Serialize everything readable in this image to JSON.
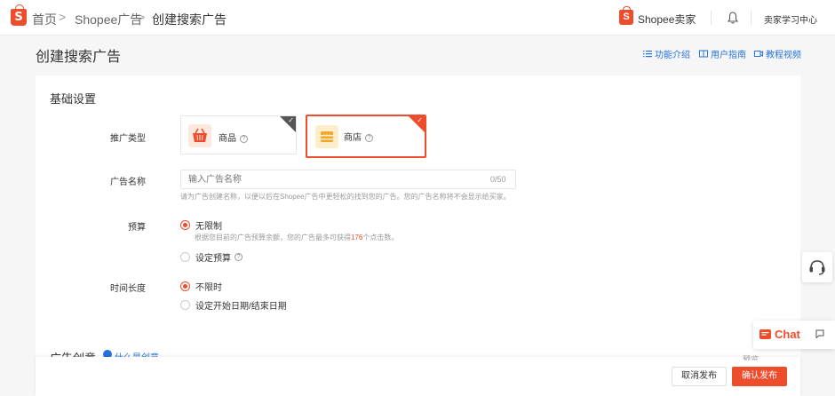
{
  "topbar": {
    "logo_letter": "S",
    "breadcrumb": [
      "首页",
      "Shopee广告",
      "创建搜索广告"
    ],
    "separator": ">",
    "brand": "Shopee卖家",
    "brand_letter": "S",
    "learning_center": "卖家学习中心"
  },
  "page": {
    "title": "创建搜索广告",
    "help_links": [
      "功能介绍",
      "用户指南",
      "教程视频"
    ]
  },
  "basic": {
    "section_title": "基础设置",
    "promo_type_label": "推广类型",
    "promo_types": [
      {
        "label": "商品",
        "selected": false
      },
      {
        "label": "商店",
        "selected": true
      }
    ],
    "qmark": "?",
    "check_mark": "✓",
    "ad_name_label": "广告名称",
    "ad_name_placeholder": "输入广告名称",
    "ad_name_counter": "0/50",
    "ad_name_hint": "请为广告创建名称，以便以后在Shopee广告中更轻松的找到您的广告。您的广告名称将不会显示给买家。",
    "budget_label": "预算",
    "budget_unlimited": "无限制",
    "budget_hint_pre": "根据您目前的广告预算余额，您的广告最多可获得",
    "budget_hint_count": "176",
    "budget_hint_post": "个点击数。",
    "budget_set": "设定预算",
    "duration_label": "时间长度",
    "duration_unlimited": "不限时",
    "duration_set": "设定开始日期/结束日期"
  },
  "creative": {
    "section_title": "广告创意",
    "link": "什么是创意",
    "partial_right": "预览"
  },
  "actions": {
    "cancel": "取消发布",
    "publish": "确认发布"
  },
  "chat": {
    "label": "Chat"
  },
  "colors": {
    "accent": "#ee4d2d",
    "link": "#2673dd"
  }
}
